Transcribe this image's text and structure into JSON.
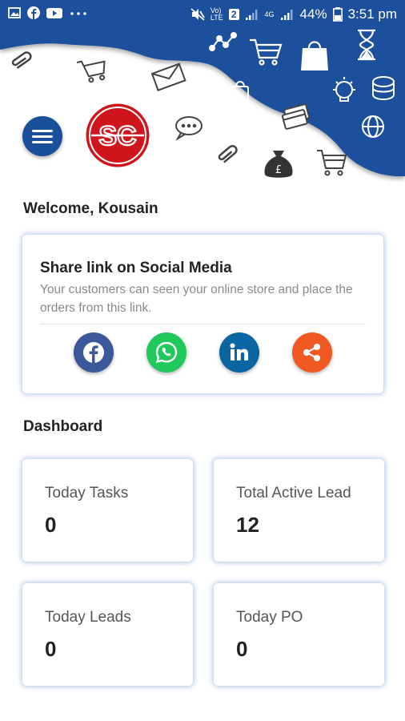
{
  "status_bar": {
    "icons_left": [
      "image-icon",
      "facebook-icon",
      "youtube-icon",
      "more-dots-icon"
    ],
    "network_label": "Vo) LTE",
    "sim_label": "2",
    "data_label": "4G",
    "battery": "44%",
    "time": "3:51 pm"
  },
  "header": {
    "brand_color": "#1a4f9c",
    "logo_text": "SC",
    "logo_color": "#d0141b"
  },
  "welcome": {
    "text": "Welcome, Kousain"
  },
  "share": {
    "title": "Share link on Social Media",
    "description": "Your customers can seen your online store and place the orders from this link.",
    "buttons": [
      {
        "name": "facebook",
        "icon": "facebook-icon",
        "color": "#3b5998"
      },
      {
        "name": "whatsapp",
        "icon": "whatsapp-icon",
        "color": "#1fc95b"
      },
      {
        "name": "linkedin",
        "icon": "linkedin-icon",
        "color": "#0a66a2"
      },
      {
        "name": "share",
        "icon": "share-icon",
        "color": "#f05a22"
      }
    ]
  },
  "dashboard": {
    "title": "Dashboard",
    "tiles": [
      {
        "label": "Today Tasks",
        "value": "0"
      },
      {
        "label": "Total Active Lead",
        "value": "12"
      },
      {
        "label": "Today Leads",
        "value": "0"
      },
      {
        "label": "Today PO",
        "value": "0"
      }
    ]
  }
}
